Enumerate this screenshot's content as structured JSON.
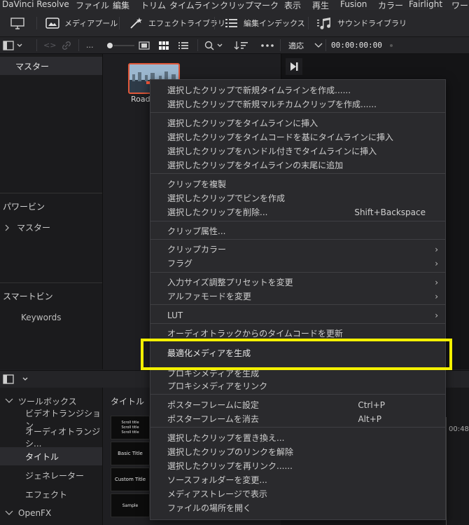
{
  "menubar": [
    "DaVinci Resolve",
    "ファイル",
    "編集",
    "トリム",
    "タイムライン",
    "クリップ",
    "マーク",
    "表示",
    "再生",
    "Fusion",
    "カラー",
    "Fairlight",
    "ワー"
  ],
  "toolbar": {
    "media_pool": "メディアプール",
    "effects_library": "エフェクトライブラリ",
    "edit_index": "編集インデックス",
    "sound_library": "サウンドライブラリ"
  },
  "toolbar2": {
    "dots": "...",
    "fit": "適応",
    "timecode": "00:00:00:00"
  },
  "sidebar": {
    "master": "マスター",
    "power_bins": "パワービン",
    "power_master": "マスター",
    "smart_bins": "スマートビン",
    "keywords": "Keywords"
  },
  "pool": {
    "clip_label": "Road"
  },
  "toolbox": {
    "header": "ツールボックス",
    "items": [
      "ビデオトランジション",
      "オーディオトランジシ...",
      "タイトル",
      "ジェネレーター",
      "エフェクト"
    ],
    "openfx": "OpenFX"
  },
  "titles_panel": {
    "header": "タイトル",
    "cards": [
      "Scroll title\nScroll title\nScroll title",
      "Basic Title",
      "Custom Title",
      "Sample"
    ]
  },
  "timeline": {
    "time": "00:48:"
  },
  "context_menu": {
    "groups": [
      [
        "選択したクリップで新規タイムラインを作成......",
        "選択したクリップで新規マルチカムクリップを作成......"
      ],
      [
        "選択したクリップをタイムラインに挿入",
        "選択したクリップをタイムコードを基にタイムラインに挿入",
        "選択したクリップをハンドル付きでタイムラインに挿入",
        "選択したクリップをタイムラインの末尾に追加"
      ],
      [
        "クリップを複製",
        "選択したクリップでビンを作成",
        "選択したクリップを削除..."
      ],
      [
        "クリップ属性..."
      ],
      [
        "クリップカラー",
        "フラグ"
      ],
      [
        "入力サイズ調整プリセットを変更",
        "アルファモードを変更"
      ],
      [
        "LUT"
      ],
      [
        "オーディオトラックからのタイムコードを更新",
        "最適化メディアを生成",
        "プロキシメディアを生成",
        "プロキシメディアをリンク"
      ],
      [
        "ポスターフレームに設定",
        "ポスターフレームを消去"
      ],
      [
        "選択したクリップを置き換え...",
        "選択したクリップのリンクを解除",
        "選択したクリップを再リンク......",
        "ソースフォルダーを変更...",
        "メディアストレージで表示",
        "ファイルの場所を開く"
      ]
    ],
    "shortcuts": {
      "delete": "Shift+Backspace",
      "set_poster": "Ctrl+P",
      "clear_poster": "Alt+P"
    }
  },
  "colors": {
    "highlight": "#f3f000",
    "clip_border": "#e0583a"
  }
}
